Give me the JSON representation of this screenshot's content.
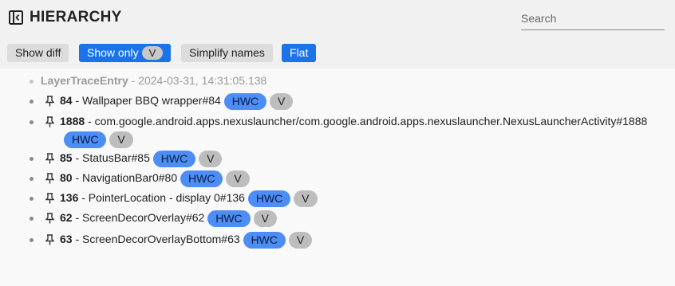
{
  "header": {
    "title": "HIERARCHY",
    "collapse_icon": "panel-collapse-icon",
    "search_placeholder": "Search"
  },
  "toolbar": {
    "show_diff": "Show diff",
    "show_only": "Show only",
    "show_only_value": "V",
    "simplify_names": "Simplify names",
    "flat": "Flat"
  },
  "tree": {
    "root": {
      "label": "LayerTraceEntry",
      "sep": " - ",
      "timestamp": "2024-03-31, 14:31:05.138"
    },
    "nodes": [
      {
        "id": "84",
        "name": " - Wallpaper BBQ wrapper#84",
        "chip1": "HWC",
        "chip2": "V"
      },
      {
        "id": "1888",
        "name": " - com.google.android.apps.nexuslauncher/com.google.android.apps.nexuslauncher.NexusLauncherActivity#1888",
        "chip1": "HWC",
        "chip2": "V"
      },
      {
        "id": "85",
        "name": " - StatusBar#85",
        "chip1": "HWC",
        "chip2": "V"
      },
      {
        "id": "80",
        "name": " - NavigationBar0#80",
        "chip1": "HWC",
        "chip2": "V"
      },
      {
        "id": "136",
        "name": " - PointerLocation - display 0#136",
        "chip1": "HWC",
        "chip2": "V"
      },
      {
        "id": "62",
        "name": " - ScreenDecorOverlay#62",
        "chip1": "HWC",
        "chip2": "V"
      },
      {
        "id": "63",
        "name": " - ScreenDecorOverlayBottom#63",
        "chip1": "HWC",
        "chip2": "V"
      }
    ]
  },
  "colors": {
    "accent": "#1a73e8",
    "chip_hwc": "#4c8df6",
    "chip_v": "#bdbdbd",
    "header_bg": "#f1f1f1"
  }
}
